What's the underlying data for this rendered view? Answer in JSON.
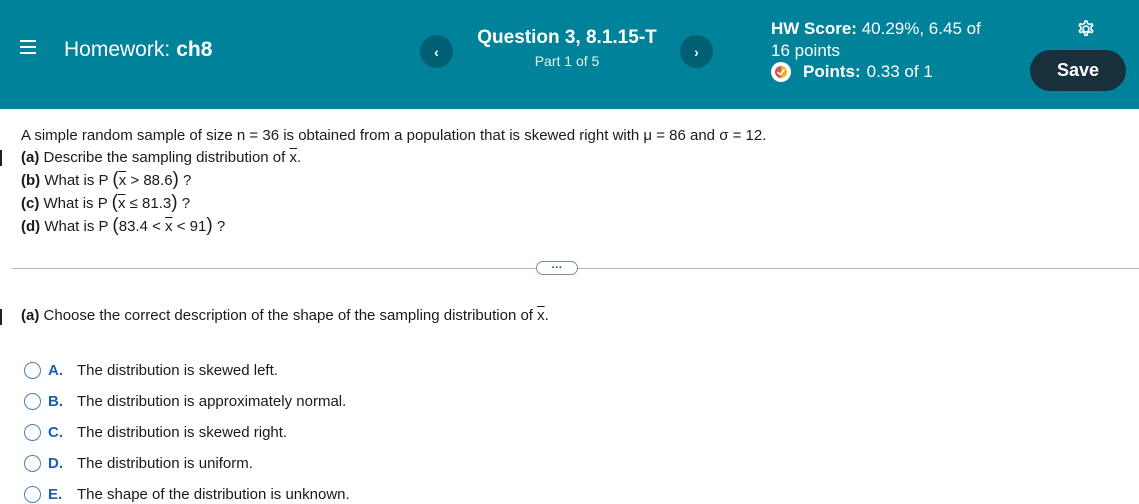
{
  "header": {
    "homework_label": "Homework:",
    "homework_name": "ch8",
    "question_title": "Question 3, 8.1.15-T",
    "part": "Part 1 of 5",
    "prev_glyph": "‹",
    "next_glyph": "›",
    "hw_score_label": "HW Score:",
    "hw_score_value": "40.29%, 6.45 of",
    "hw_score_total": "16 points",
    "points_label": "Points:",
    "points_value": "0.33 of 1",
    "save_label": "Save",
    "colors": {
      "bar": "#00829b",
      "save": "#17303b",
      "nav": "#005f73"
    }
  },
  "problem": {
    "intro": "A simple random sample of size n = 36 is obtained from a population that is skewed right with μ = 86 and σ = 12.",
    "a_letter": "(a)",
    "a_text": "Describe the sampling distribution of",
    "a_var": "x",
    "a_end": ".",
    "b_letter": "(b)",
    "b_prefix": "What is P",
    "b_var": "x",
    "b_rest": " > 88.6",
    "c_letter": "(c)",
    "c_prefix": "What is P",
    "c_var": "x",
    "c_rest": " ≤ 81.3",
    "d_letter": "(d)",
    "d_prefix": "What is P",
    "d_before": "83.4 < ",
    "d_var": "x",
    "d_after": " < 91",
    "qmark": "?",
    "open_paren": "(",
    "close_paren": ")"
  },
  "expand_label": "···",
  "question": {
    "letter": "(a)",
    "text": "Choose the correct description of the shape of the sampling distribution of",
    "var": "x",
    "end": "."
  },
  "choices": [
    {
      "letter": "A.",
      "text": "The distribution is skewed left."
    },
    {
      "letter": "B.",
      "text": "The distribution is approximately normal."
    },
    {
      "letter": "C.",
      "text": "The distribution is skewed right."
    },
    {
      "letter": "D.",
      "text": "The distribution is uniform."
    },
    {
      "letter": "E.",
      "text": "The shape of the distribution is unknown."
    }
  ]
}
